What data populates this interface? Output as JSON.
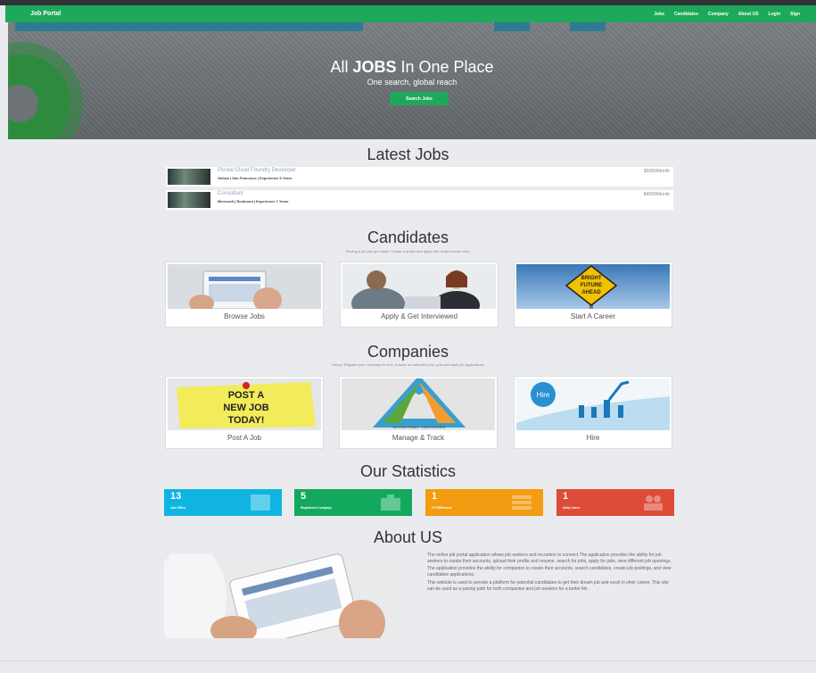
{
  "navbar": {
    "brand": "Job Portal",
    "links": [
      "Jobs",
      "Candidates",
      "Company",
      "About US",
      "Login",
      "Sign"
    ]
  },
  "hero": {
    "title_prefix": "All ",
    "title_bold": "JOBS",
    "title_suffix": " In One Place",
    "subtitle": "One search, global reach",
    "button": "Search Jobs"
  },
  "latest_jobs": {
    "heading": "Latest Jobs",
    "items": [
      {
        "title": "Pivotal Cloud Foundry Developer",
        "meta": "Github | San Francisco | Experience 5 Years",
        "salary": "$5000/Month"
      },
      {
        "title": "Consultant",
        "meta": "Microsoft | Redmond | Experience 7 Years",
        "salary": "$4000/Month"
      }
    ]
  },
  "candidates": {
    "heading": "Candidates",
    "subtitle": "Finding a job just got easier. Create a profile and apply with single mouse click.",
    "cards": [
      {
        "label": "Browse Jobs"
      },
      {
        "label": "Apply & Get Interviewed"
      },
      {
        "label": "Start A Career",
        "sign_line1": "BRIGHT",
        "sign_line2": "FUTURE",
        "sign_line3": "AHEAD"
      }
    ]
  },
  "companies": {
    "heading": "Companies",
    "subtitle": "Hiring? Register your company for free, browse our talented pool, post and track job applications",
    "cards": [
      {
        "label": "Post A Job",
        "note_line1": "POST A",
        "note_line2": "NEW JOB",
        "note_line3": "TODAY!"
      },
      {
        "label": "Manage & Track",
        "cycle_text": "ACTION ITEMS · LOG ENTRIES"
      },
      {
        "label": "Hire",
        "bubble": "Hire"
      }
    ]
  },
  "statistics": {
    "heading": "Our Statistics",
    "items": [
      {
        "value": "13",
        "caption": "Job Offers",
        "color": "#0fb5e0"
      },
      {
        "value": "5",
        "caption": "Registered Company",
        "color": "#12a95c"
      },
      {
        "value": "1",
        "caption": "CV'S/Resume",
        "color": "#f39c12"
      },
      {
        "value": "1",
        "caption": "Daily Users",
        "color": "#dd4b39"
      }
    ]
  },
  "about": {
    "heading": "About US",
    "para1": "The online job portal application allows job seekers and recruiters to connect.The application provides the ability for job seekers to create their accounts, upload their profile and resume, search for jobs, apply for jobs, view different job openings. The application provides the ability for companies to create their accounts, search candidates, create job postings, and view candidates applications.",
    "para2": "This website is used to provide a platform for potential candidates to get their dream job and excel in yheir career. This site can be used as a paving path for both companies and job-seekers for a better life ."
  },
  "footer": {
    "text": ""
  }
}
